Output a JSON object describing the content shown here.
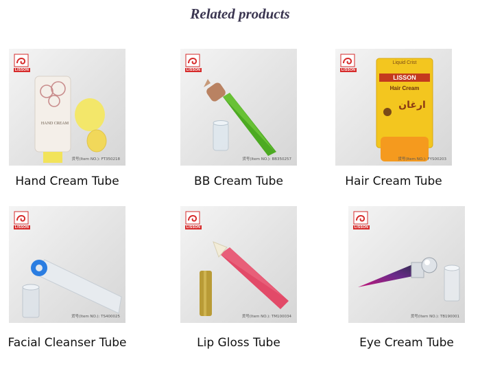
{
  "section": {
    "title": "Related products"
  },
  "logo": {
    "brand_text": "LISSON"
  },
  "products": [
    {
      "name": "Hand Cream Tube",
      "item_no": "货号(Item NO.): FT350218",
      "label_text": "HAND CREAM"
    },
    {
      "name": "BB Cream Tube",
      "item_no": "货号(Item NO.): BB350257"
    },
    {
      "name": "Hair Cream Tube",
      "item_no": "货号(Item NO.): FYS00203",
      "label_brand": "LISSON",
      "label_line": "Hair Cream",
      "label_arabic": "ارغان",
      "label_top": "Liquid Crist"
    },
    {
      "name": "Facial Cleanser Tube",
      "item_no": "货号(Item NO.): TS400025"
    },
    {
      "name": "Lip Gloss Tube",
      "item_no": "货号(Item NO.): TM100034"
    },
    {
      "name": "Eye Cream Tube",
      "item_no": "货号(Item NO.): TB190001"
    }
  ],
  "colors": {
    "title": "#3a3550",
    "brand_red": "#d62b2b",
    "caption": "#111111"
  }
}
